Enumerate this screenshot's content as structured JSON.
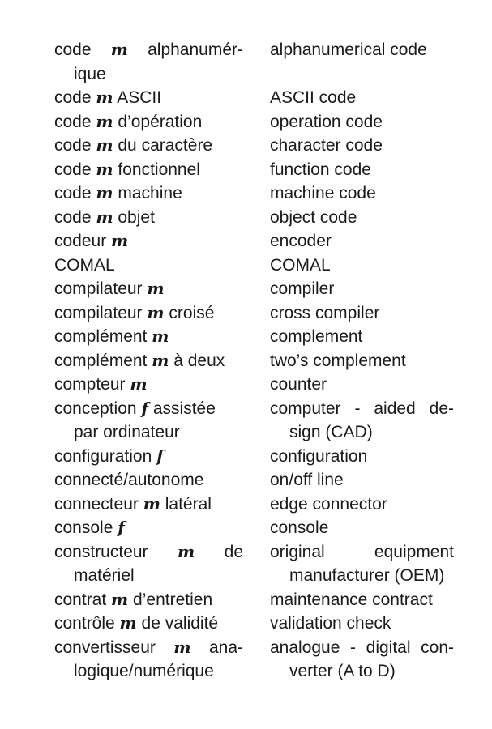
{
  "entries": [
    {
      "fr": [
        [
          [
            "code ",
            "m",
            " alphanumér-"
          ],
          true
        ],
        [
          [
            "ique"
          ],
          false
        ]
      ],
      "en": [
        [
          "alphanumerical code",
          false
        ]
      ]
    },
    {
      "fr": [
        [
          [
            "code ",
            "m",
            " ASCII"
          ],
          false
        ]
      ],
      "en": [
        [
          "ASCII code",
          false
        ]
      ]
    },
    {
      "fr": [
        [
          [
            "code ",
            "m",
            " d’opération"
          ],
          false
        ]
      ],
      "en": [
        [
          "operation code",
          false
        ]
      ]
    },
    {
      "fr": [
        [
          [
            "code ",
            "m",
            " du caractère"
          ],
          false
        ]
      ],
      "en": [
        [
          "character code",
          false
        ]
      ]
    },
    {
      "fr": [
        [
          [
            "code ",
            "m",
            " fonctionnel"
          ],
          false
        ]
      ],
      "en": [
        [
          "function code",
          false
        ]
      ]
    },
    {
      "fr": [
        [
          [
            "code ",
            "m",
            " machine"
          ],
          false
        ]
      ],
      "en": [
        [
          "machine code",
          false
        ]
      ]
    },
    {
      "fr": [
        [
          [
            "code ",
            "m",
            " objet"
          ],
          false
        ]
      ],
      "en": [
        [
          "object code",
          false
        ]
      ]
    },
    {
      "fr": [
        [
          [
            "codeur ",
            "m",
            ""
          ],
          false
        ]
      ],
      "en": [
        [
          "encoder",
          false
        ]
      ]
    },
    {
      "fr": [
        [
          [
            "COMAL"
          ],
          false
        ]
      ],
      "en": [
        [
          "COMAL",
          false
        ]
      ]
    },
    {
      "fr": [
        [
          [
            "compilateur ",
            "m",
            ""
          ],
          false
        ]
      ],
      "en": [
        [
          "compiler",
          false
        ]
      ]
    },
    {
      "fr": [
        [
          [
            "compilateur ",
            "m",
            " croisé"
          ],
          false
        ]
      ],
      "en": [
        [
          "cross compiler",
          false
        ]
      ]
    },
    {
      "fr": [
        [
          [
            "complément ",
            "m",
            ""
          ],
          false
        ]
      ],
      "en": [
        [
          "complement",
          false
        ]
      ]
    },
    {
      "fr": [
        [
          [
            "complément ",
            "m",
            " à deux"
          ],
          false
        ]
      ],
      "en": [
        [
          "two’s complement",
          false
        ]
      ]
    },
    {
      "fr": [
        [
          [
            "compteur ",
            "m",
            ""
          ],
          false
        ]
      ],
      "en": [
        [
          "counter",
          false
        ]
      ]
    },
    {
      "fr": [
        [
          [
            "conception ",
            "f",
            " assistée"
          ],
          false
        ],
        [
          [
            "par ordinateur"
          ],
          false
        ]
      ],
      "en": [
        [
          "computer - aided de-",
          true
        ],
        [
          "sign (CAD)",
          false
        ]
      ]
    },
    {
      "fr": [
        [
          [
            "configuration ",
            "f",
            ""
          ],
          false
        ]
      ],
      "en": [
        [
          "configuration",
          false
        ]
      ]
    },
    {
      "fr": [
        [
          [
            "connecté/autonome"
          ],
          false
        ]
      ],
      "en": [
        [
          "on/off line",
          false
        ]
      ]
    },
    {
      "fr": [
        [
          [
            "connecteur ",
            "m",
            " latéral"
          ],
          false
        ]
      ],
      "en": [
        [
          "edge connector",
          false
        ]
      ]
    },
    {
      "fr": [
        [
          [
            "console ",
            "f",
            ""
          ],
          false
        ]
      ],
      "en": [
        [
          "console",
          false
        ]
      ]
    },
    {
      "fr": [
        [
          [
            "constructeur ",
            "m",
            " de"
          ],
          true
        ],
        [
          [
            "matériel"
          ],
          false
        ]
      ],
      "en": [
        [
          "original equipment",
          true
        ],
        [
          "manufacturer (OEM)",
          false
        ]
      ]
    },
    {
      "fr": [
        [
          [
            "contrat ",
            "m",
            " d’entretien"
          ],
          false
        ]
      ],
      "en": [
        [
          "maintenance contract",
          false
        ]
      ]
    },
    {
      "fr": [
        [
          [
            "contrôle ",
            "m",
            " de validité"
          ],
          false
        ]
      ],
      "en": [
        [
          "validation check",
          false
        ]
      ]
    },
    {
      "fr": [
        [
          [
            "convertisseur ",
            "m",
            " ana-"
          ],
          true
        ],
        [
          [
            "logique/numérique"
          ],
          false
        ]
      ],
      "en": [
        [
          "analogue - digital con-",
          true
        ],
        [
          "verter (A to D)",
          false
        ]
      ]
    }
  ]
}
